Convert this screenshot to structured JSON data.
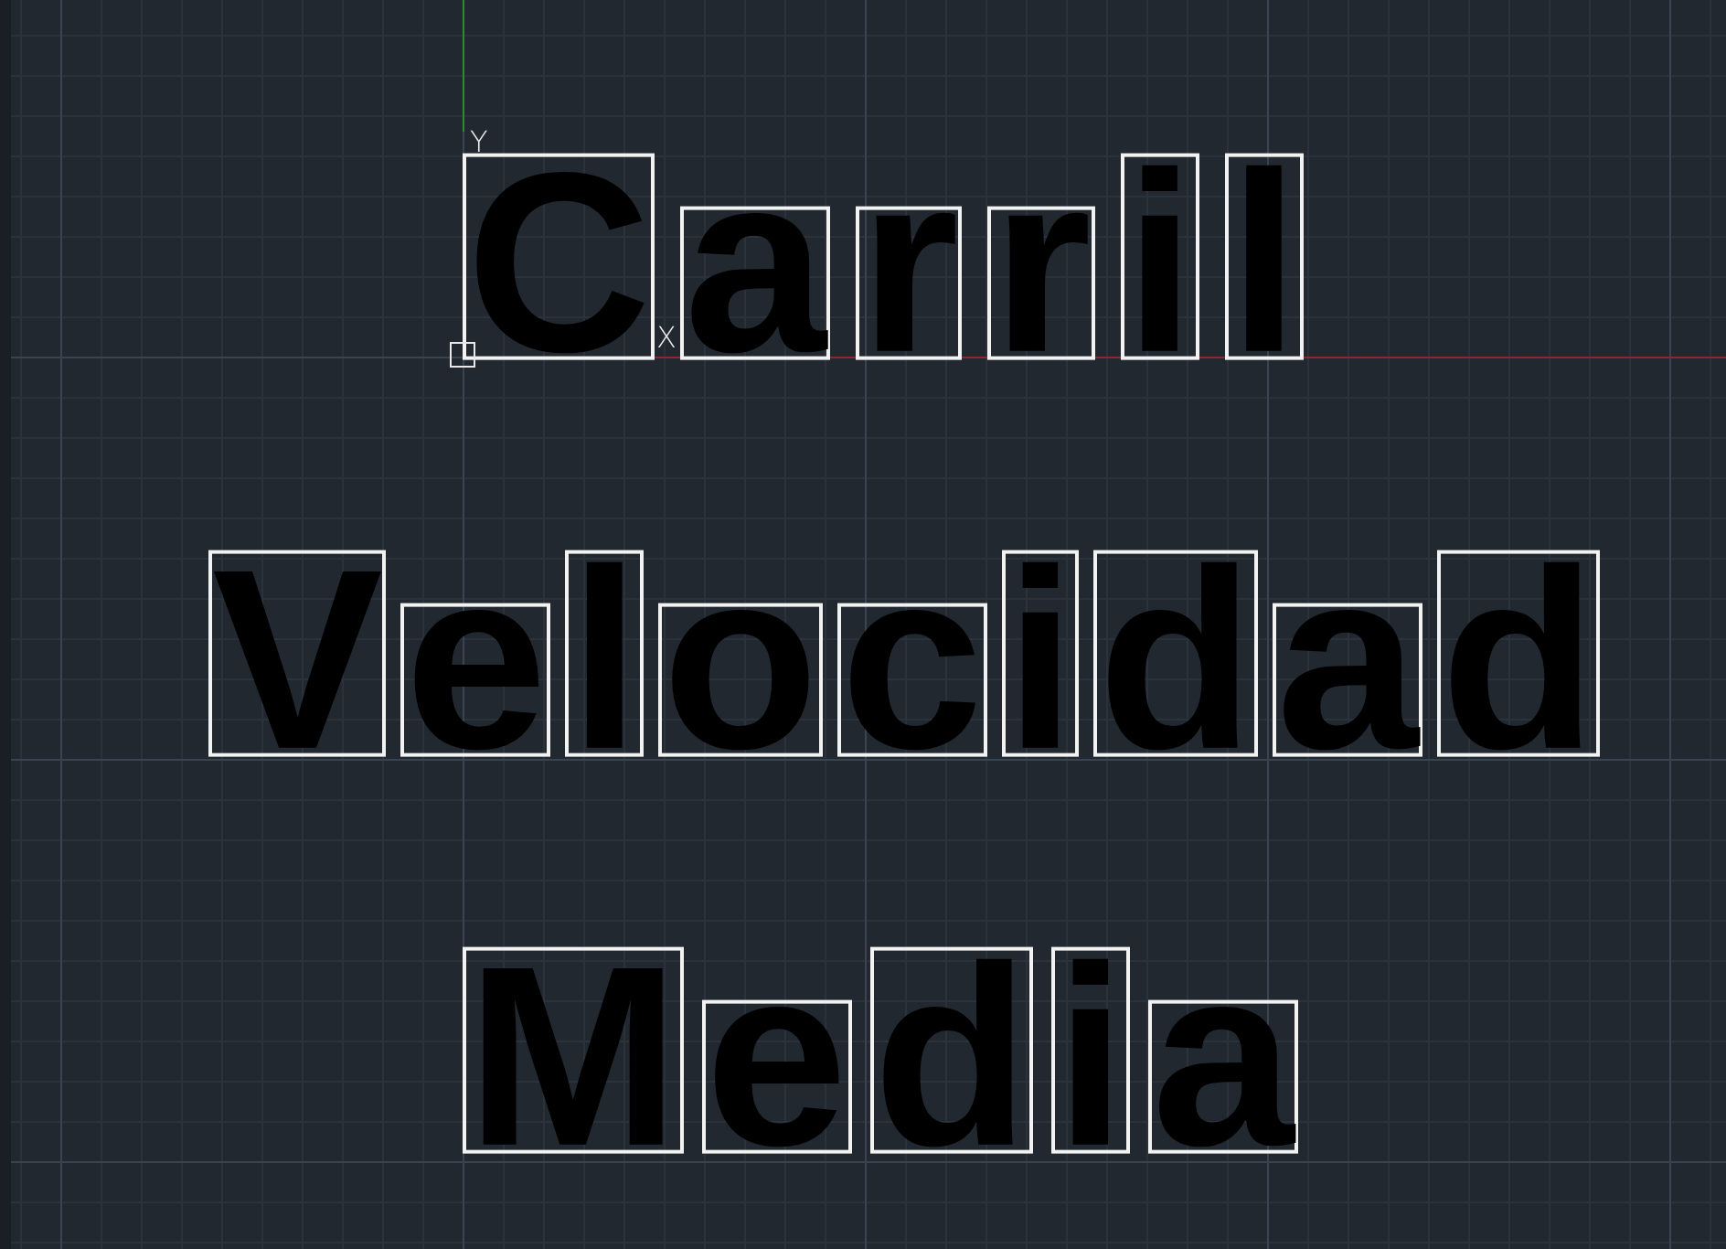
{
  "ucs_icon": {
    "x_label": "X",
    "y_label": "Y"
  },
  "text_lines": [
    {
      "letters": [
        {
          "char": "C",
          "kind": "cap"
        },
        {
          "char": "a",
          "kind": "short"
        },
        {
          "char": "r",
          "kind": "short"
        },
        {
          "char": "r",
          "kind": "short"
        },
        {
          "char": "i",
          "kind": "tall"
        },
        {
          "char": "l",
          "kind": "tall"
        }
      ]
    },
    {
      "letters": [
        {
          "char": "V",
          "kind": "cap"
        },
        {
          "char": "e",
          "kind": "short"
        },
        {
          "char": "l",
          "kind": "tall"
        },
        {
          "char": "o",
          "kind": "short"
        },
        {
          "char": "c",
          "kind": "short"
        },
        {
          "char": "i",
          "kind": "tall"
        },
        {
          "char": "d",
          "kind": "tall"
        },
        {
          "char": "a",
          "kind": "short"
        },
        {
          "char": "d",
          "kind": "tall"
        }
      ]
    },
    {
      "letters": [
        {
          "char": "M",
          "kind": "cap"
        },
        {
          "char": "e",
          "kind": "short"
        },
        {
          "char": "d",
          "kind": "tall"
        },
        {
          "char": "i",
          "kind": "tall"
        },
        {
          "char": "a",
          "kind": "short"
        }
      ]
    }
  ]
}
